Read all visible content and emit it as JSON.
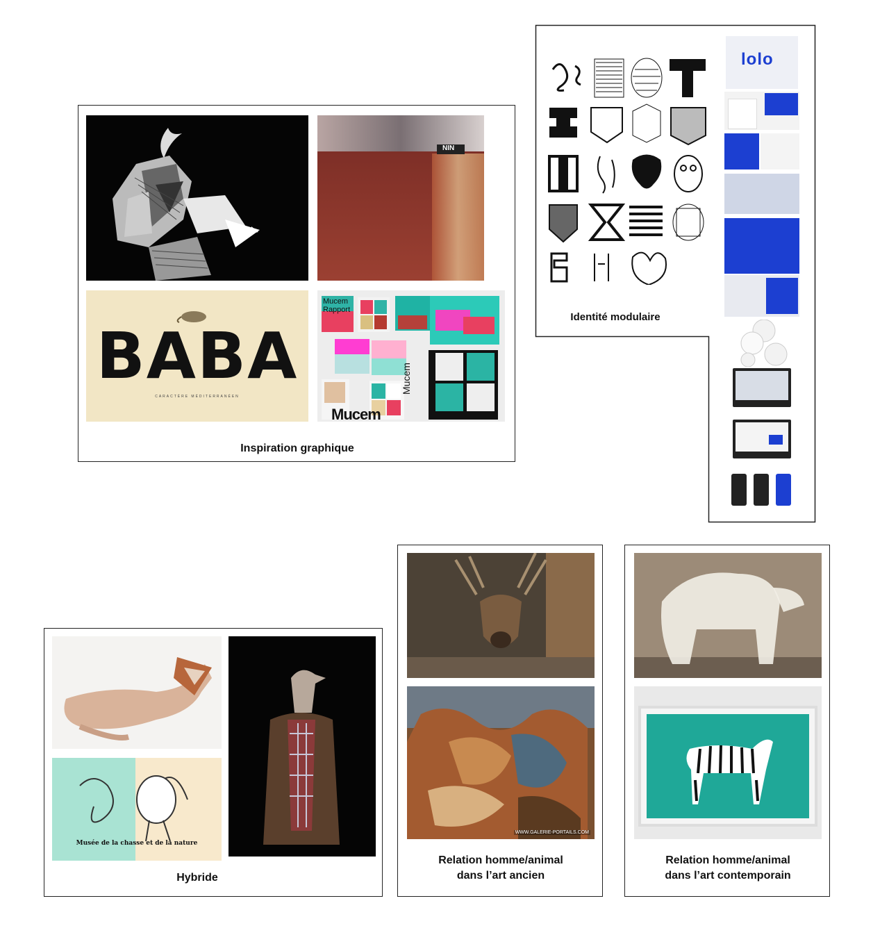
{
  "panels": {
    "inspiration": {
      "caption": "Inspiration graphique",
      "images": [
        {
          "name": "black-white-collage-image"
        },
        {
          "name": "red-abstract-album-cover",
          "label": "NIN"
        },
        {
          "name": "baba-typeface-poster",
          "title": "BABA",
          "subtitle": "CARACTÈRE MÉDITERRANÉEN"
        },
        {
          "name": "mucem-report-layouts",
          "labels": [
            "Mucem",
            "Rapport",
            "Mucem",
            "Mucem"
          ]
        }
      ]
    },
    "identite": {
      "caption": "Identité modulaire",
      "logo_text": "lolo",
      "brand_blue": "#1c3fd1"
    },
    "hybride": {
      "caption": "Hybride",
      "museum_title": "Musée de la chasse et de la nature"
    },
    "ancien": {
      "caption_line1": "Relation homme/animal",
      "caption_line2": "dans l’art ancien",
      "watermark": "WWW.GALERIE-PORTAILS.COM"
    },
    "contemporain": {
      "caption_line1": "Relation homme/animal",
      "caption_line2": "dans l’art contemporain"
    }
  }
}
